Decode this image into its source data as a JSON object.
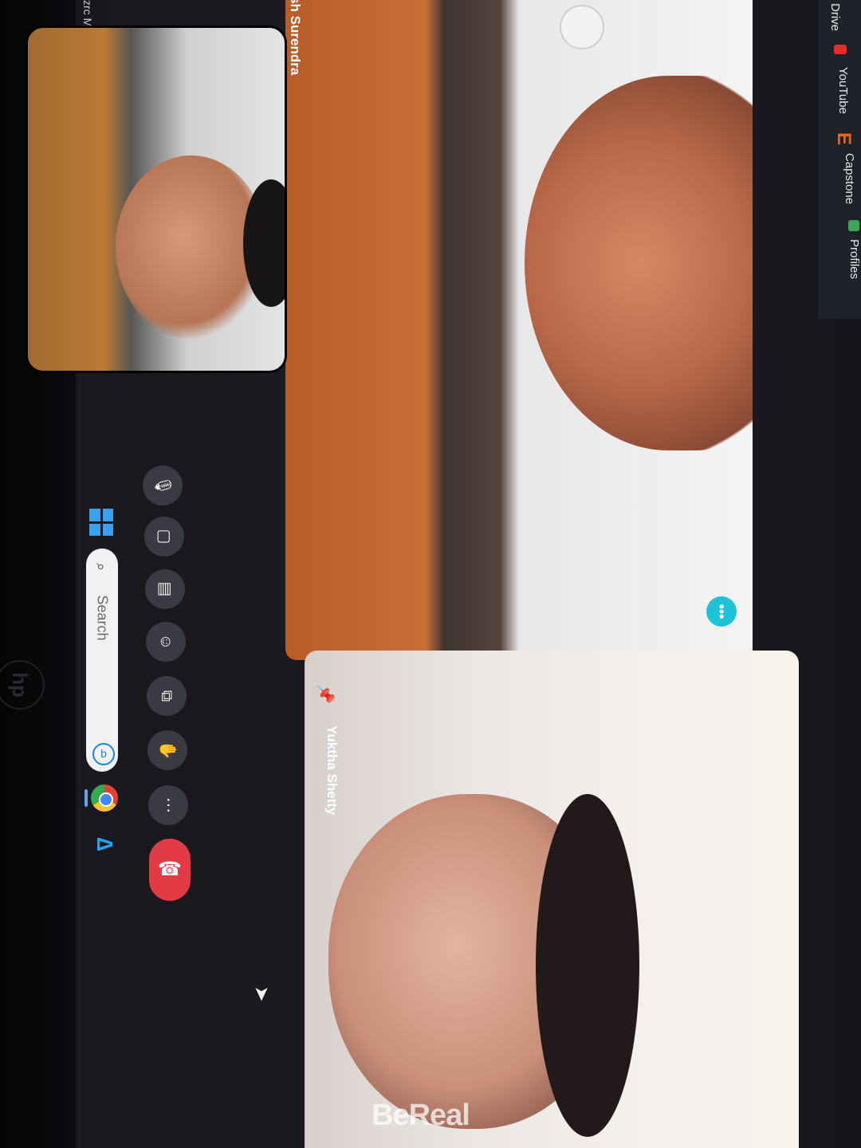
{
  "taskbar": {
    "search_placeholder": "Search",
    "icons": [
      "windows-start-icon",
      "search-icon",
      "bing-icon",
      "chrome-icon",
      "azure-icon"
    ]
  },
  "meeting": {
    "participants": [
      {
        "name": "nish Surendra",
        "pinned": false
      },
      {
        "name": "Yuktha Shetty",
        "pinned": true
      }
    ],
    "controls": [
      {
        "name": "microphone",
        "icon": "microphone-icon"
      },
      {
        "name": "camera",
        "icon": "camera-icon"
      },
      {
        "name": "captions",
        "icon": "captions-icon"
      },
      {
        "name": "reactions",
        "icon": "emoji-icon"
      },
      {
        "name": "present",
        "icon": "present-icon"
      },
      {
        "name": "raise-hand",
        "icon": "hand-icon"
      },
      {
        "name": "more-options",
        "icon": "more-icon"
      },
      {
        "name": "end-call",
        "icon": "phone-hangup-icon"
      }
    ],
    "end_call_color": "#e23b45",
    "tile_menu_color": "#1fc3d6"
  },
  "bookmarks": {
    "items": [
      "Drive",
      "YouTube",
      "Capstone",
      "Profiles"
    ]
  },
  "partial_text": "zrc  Mo",
  "watermark": "BeReal"
}
